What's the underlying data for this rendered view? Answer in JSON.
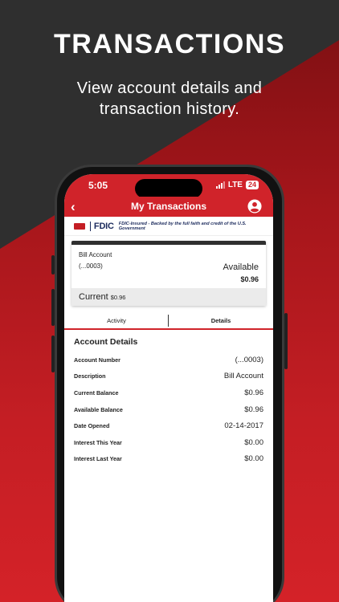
{
  "promo": {
    "headline": "TRANSACTIONS",
    "subline_1": "View account details and",
    "subline_2": "transaction history."
  },
  "status_bar": {
    "time": "5:05",
    "network": "LTE",
    "battery": "24"
  },
  "nav": {
    "title": "My Transactions",
    "back_icon": "chevron-left-icon",
    "profile_icon": "user-circle-icon"
  },
  "fdic": {
    "logo": "FDIC",
    "text": "FDIC-Insured - Backed by the full faith and credit of the U.S. Government"
  },
  "account": {
    "name": "Bill Account",
    "number": "(...0003)",
    "available_label": "Available",
    "available_value": "$0.96",
    "current_label": "Current",
    "current_value": "$0.96"
  },
  "tabs": [
    {
      "label": "Activity",
      "active": false
    },
    {
      "label": "Details",
      "active": true
    }
  ],
  "details": {
    "title": "Account Details",
    "rows": [
      {
        "label": "Account Number",
        "value": "(...0003)"
      },
      {
        "label": "Description",
        "value": "Bill Account"
      },
      {
        "label": "Current Balance",
        "value": "$0.96"
      },
      {
        "label": "Available Balance",
        "value": "$0.96"
      },
      {
        "label": "Date Opened",
        "value": "02-14-2017"
      },
      {
        "label": "Interest This Year",
        "value": "$0.00"
      },
      {
        "label": "Interest Last Year",
        "value": "$0.00"
      }
    ]
  },
  "colors": {
    "brand_red": "#d0232a",
    "dark_bg": "#2f2f2f",
    "fdic_navy": "#1b2a5c"
  }
}
